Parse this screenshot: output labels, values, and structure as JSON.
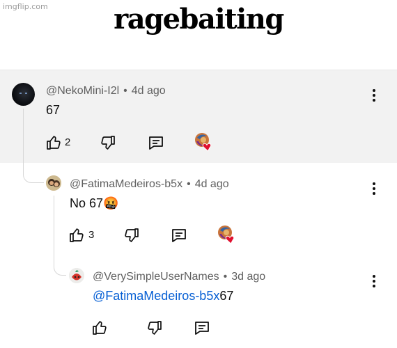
{
  "watermark": "imgflip.com",
  "caption": "ragebaiting",
  "comments": [
    {
      "author": "@NekoMini-I2l",
      "separator": "•",
      "time": "4d ago",
      "text": "67",
      "like_count": "2",
      "actions": [
        "like-icon",
        "dislike-icon",
        "reply-icon",
        "creator-heart-icon"
      ]
    },
    {
      "author": "@FatimaMedeiros-b5x",
      "separator": "•",
      "time": "4d ago",
      "text": "No 67",
      "emoji": "🤬",
      "like_count": "3",
      "actions": [
        "like-icon",
        "dislike-icon",
        "reply-icon",
        "creator-heart-icon"
      ]
    },
    {
      "author": "@VerySimpleUserNames",
      "separator": "•",
      "time": "3d ago",
      "mention": "@FatimaMedeiros-b5x",
      "text": "67",
      "actions": [
        "like-icon",
        "dislike-icon",
        "reply-icon"
      ]
    }
  ],
  "colors": {
    "mention": "#065fd4",
    "highlight": "#f2f2f2",
    "meta": "#606060",
    "heart": "#e0102f"
  }
}
